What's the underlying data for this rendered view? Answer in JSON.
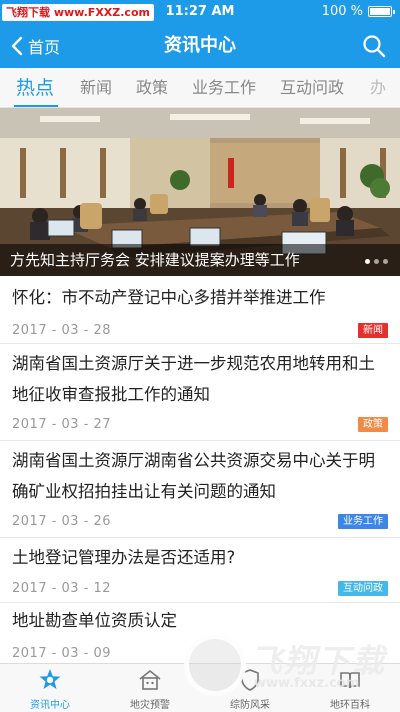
{
  "watermark_top": {
    "brand": "飞翔下载",
    "url": "www.FXXZ.com"
  },
  "status_bar": {
    "time": "11:27 AM",
    "battery": "100 %"
  },
  "nav": {
    "back_label": "首页",
    "title": "资讯中心"
  },
  "tabs": [
    {
      "label": "热点",
      "active": true
    },
    {
      "label": "新闻"
    },
    {
      "label": "政策"
    },
    {
      "label": "业务工作"
    },
    {
      "label": "互动问政"
    },
    {
      "label": "办"
    }
  ],
  "banner": {
    "caption": "方先知主持厅务会  安排建议提案办理等工作",
    "dots": 3,
    "active_dot": 0
  },
  "news": [
    {
      "title": "怀化：市不动产登记中心多措并举推进工作",
      "date": "2017 - 03 - 28",
      "badge": "新闻",
      "badge_color": "#e4312e"
    },
    {
      "title": "湖南省国土资源厅关于进一步规范农用地转用和土地征收审查报批工作的通知",
      "date": "2017 - 03 - 27",
      "badge": "政策",
      "badge_color": "#f08a45"
    },
    {
      "title": "湖南省国土资源厅湖南省公共资源交易中心关于明确矿业权招拍挂出让有关问题的通知",
      "date": "2017 - 03 - 26",
      "badge": "业务工作",
      "badge_color": "#3e86e4"
    },
    {
      "title": "土地登记管理办法是否还适用?",
      "date": "2017 - 03 - 12",
      "badge": "互动问政",
      "badge_color": "#46b8e8"
    },
    {
      "title": "地址勘查单位资质认定",
      "date": "2017 - 03 - 09",
      "badge": "",
      "badge_color": ""
    }
  ],
  "tabbar": [
    {
      "label": "资讯中心",
      "icon": "star-badge-icon",
      "active": true
    },
    {
      "label": "地灾预警",
      "icon": "house-alert-icon"
    },
    {
      "label": "综防风采",
      "icon": "shield-icon"
    },
    {
      "label": "地环百科",
      "icon": "book-icon"
    }
  ],
  "watermark_bottom": {
    "brand": "飞翔下载",
    "url": "www.fxxz.com"
  },
  "colors": {
    "primary": "#1e9be8"
  }
}
